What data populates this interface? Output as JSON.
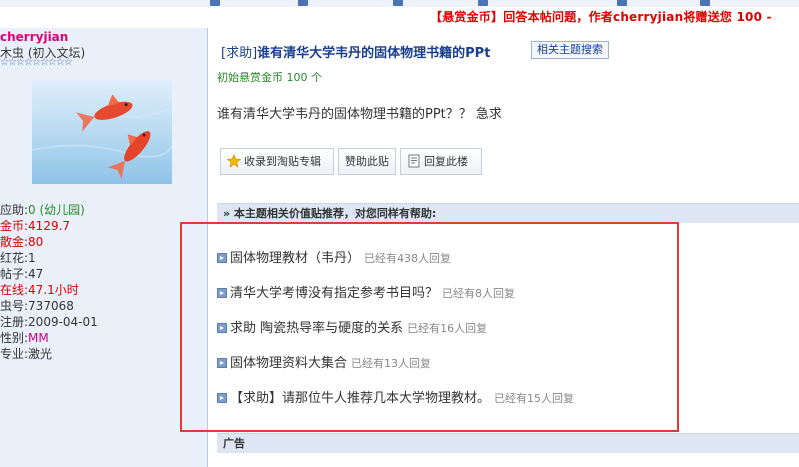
{
  "bounty_notice": "【悬赏金币】回答本帖问题，作者cherryjian将赠送您 100 -",
  "user": {
    "username": "cherryjian",
    "rank": "木虫 (初入文坛)",
    "stars": "☆☆☆☆☆☆☆☆☆",
    "stats": [
      {
        "label": "应助:",
        "value": "0 (幼儿园)",
        "style": "green"
      },
      {
        "label": "金币:",
        "value": "4129.7",
        "style": "red"
      },
      {
        "label": "散金:",
        "value": "80",
        "style": "red"
      },
      {
        "label": "红花:",
        "value": "1",
        "style": "plain"
      },
      {
        "label": "帖子:",
        "value": "47",
        "style": "plain"
      },
      {
        "label": "在线:",
        "value": "47.1小时",
        "style": "red"
      },
      {
        "label": "虫号:",
        "value": "737068",
        "style": "plain"
      },
      {
        "label": "注册:",
        "value": "2009-04-01",
        "style": "plain"
      },
      {
        "label": "性别:",
        "value": "MM",
        "style": "pink"
      },
      {
        "label": "专业:",
        "value": "激光",
        "style": "plain"
      }
    ]
  },
  "thread": {
    "tag": "[求助]",
    "title": "谁有清华大学韦丹的固体物理书籍的PPt",
    "related_button": "相关主题搜索",
    "reward": "初始悬赏金币 100 个",
    "body": "谁有清华大学韦丹的固体物理书籍的PPt？？   急求"
  },
  "actions": {
    "collect": "收录到淘贴专辑",
    "sponsor": "赞助此贴",
    "reply": "回复此楼"
  },
  "recommend": {
    "header": "» 本主题相关价值贴推荐，对您同样有帮助:",
    "items": [
      {
        "title": "固体物理教材（韦丹）",
        "count": "已经有438人回复"
      },
      {
        "title": "清华大学考博没有指定参考书目吗？",
        "count": "已经有8人回复"
      },
      {
        "title": "求助 陶瓷热导率与硬度的关系",
        "count": "已经有16人回复"
      },
      {
        "title": "固体物理资料大集合",
        "count": "已经有13人回复"
      },
      {
        "title": "【求助】请那位牛人推荐几本大学物理教材。",
        "count": "已经有15人回复"
      }
    ]
  },
  "ad_header": "广告",
  "colors": {
    "accent_red": "#e30000",
    "link_blue": "#1a3f8c",
    "annotation_box": "#e53935"
  }
}
